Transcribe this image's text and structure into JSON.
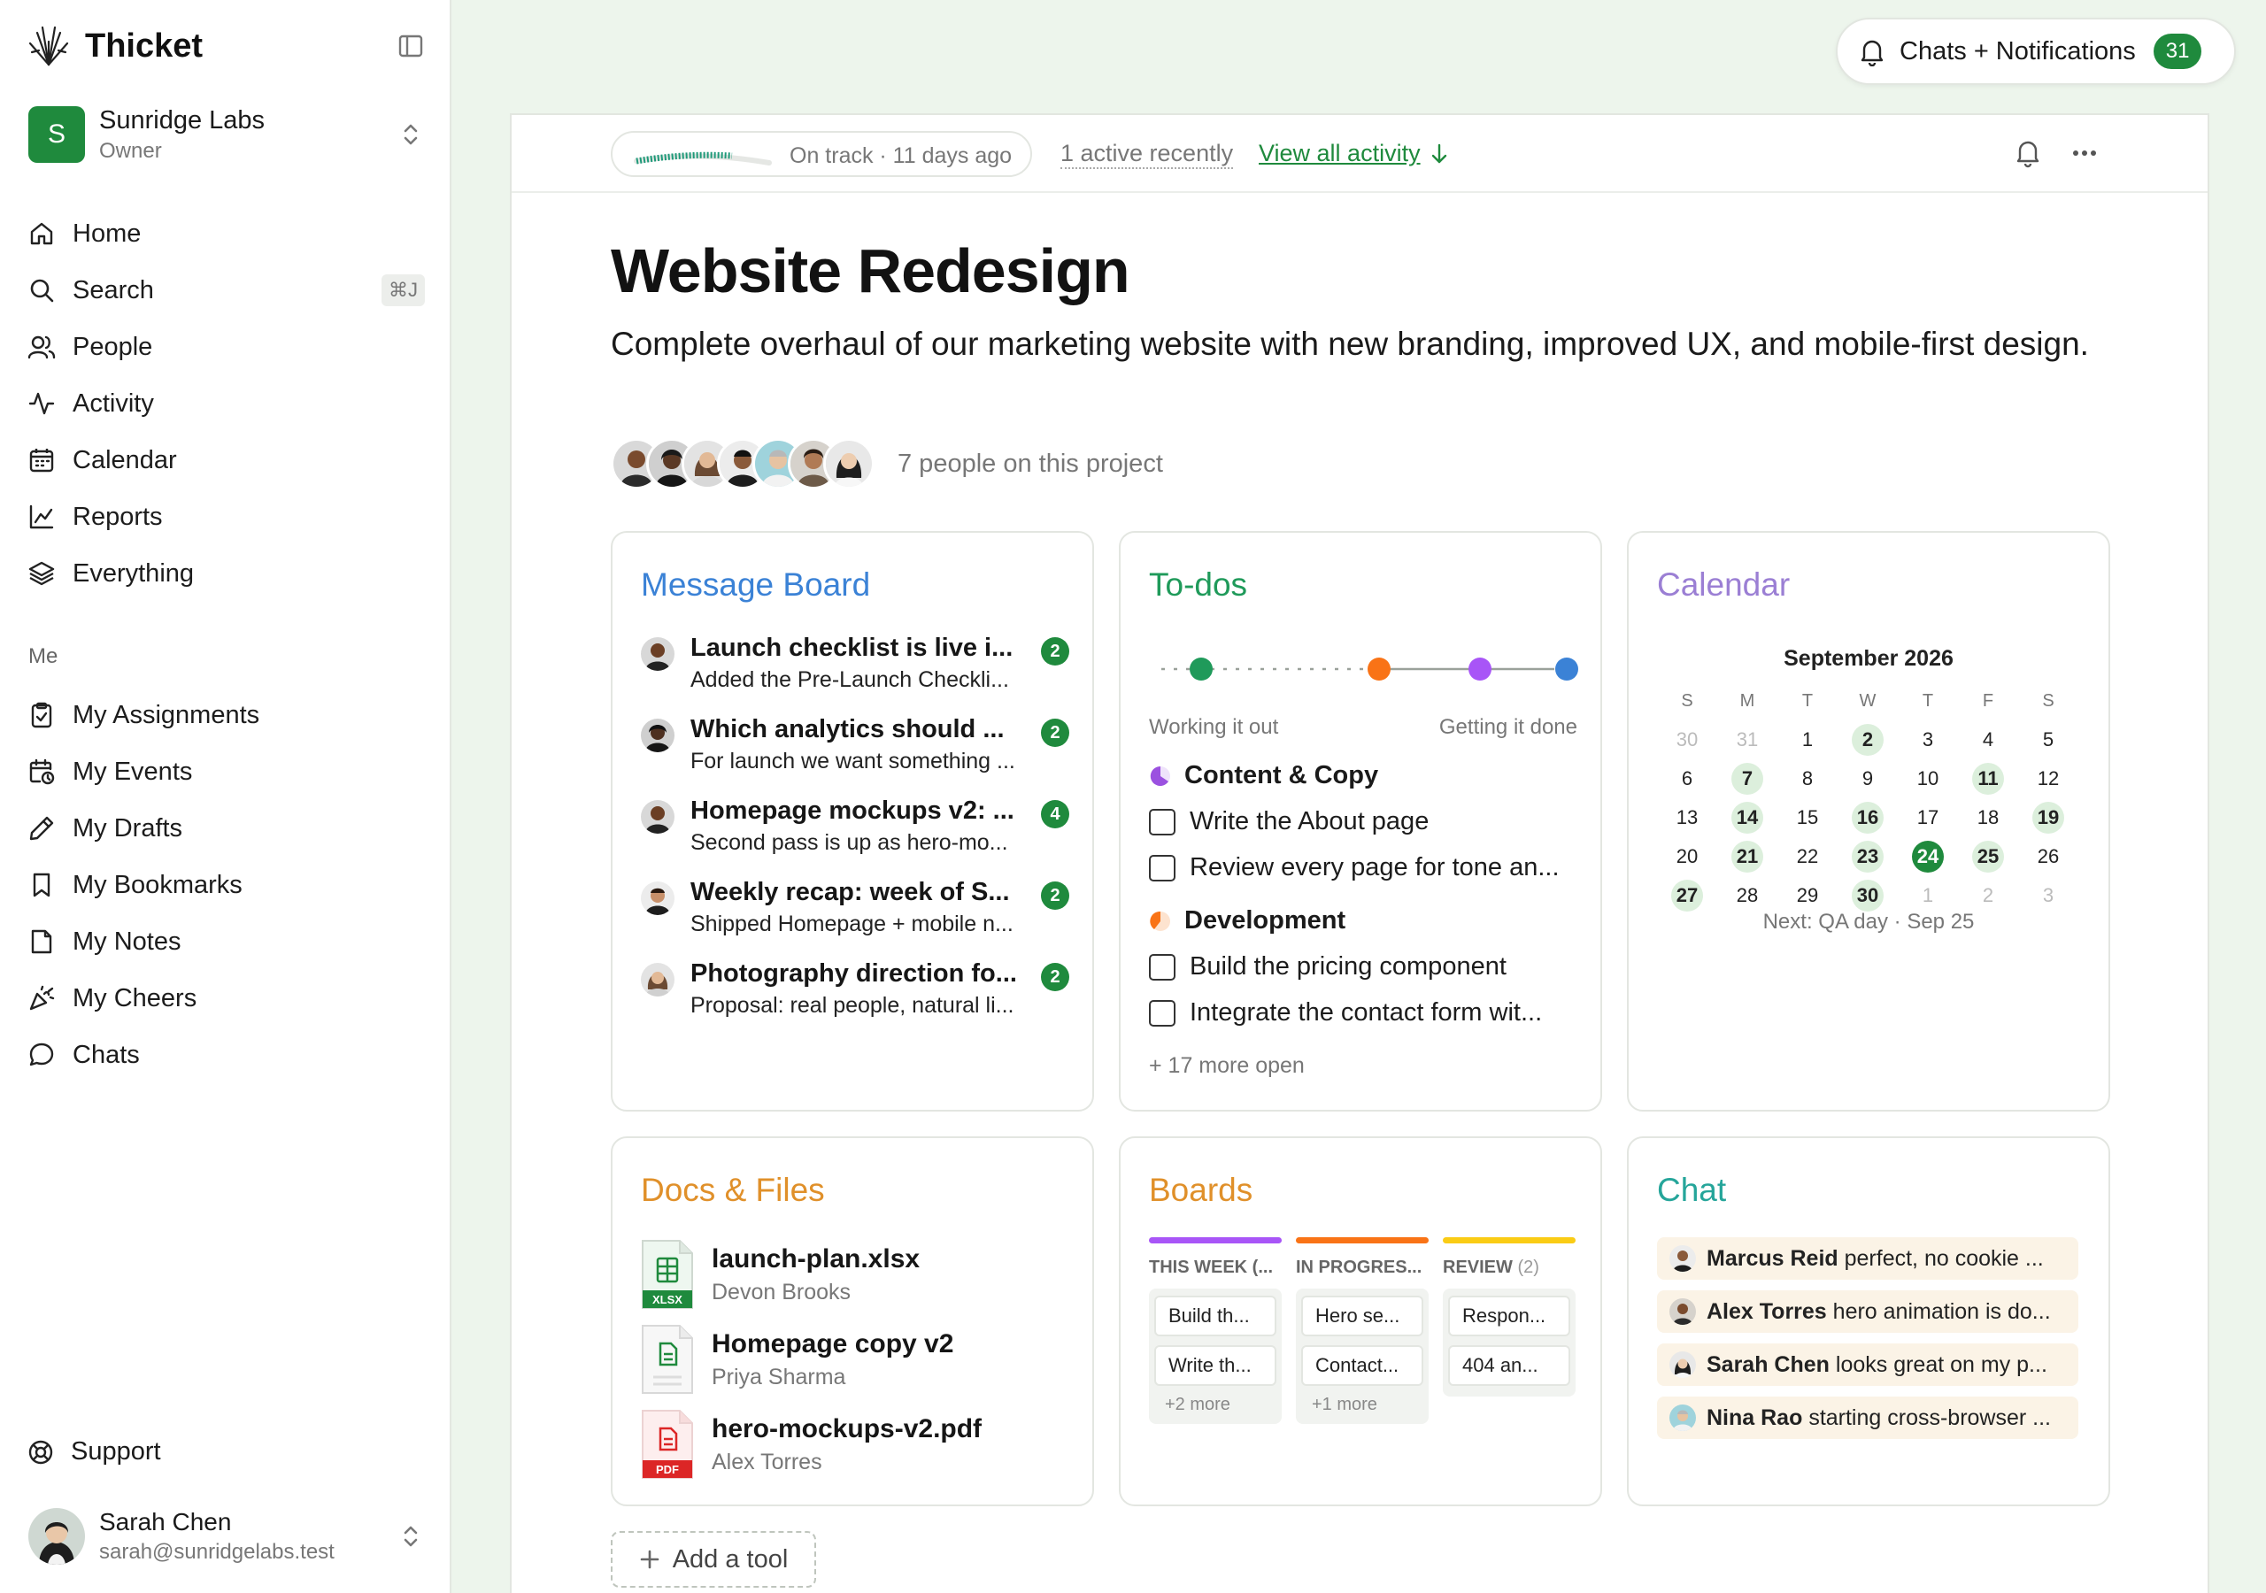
{
  "app": {
    "name": "Thicket"
  },
  "org": {
    "initial": "S",
    "name": "Sunridge Labs",
    "role": "Owner"
  },
  "nav": [
    {
      "label": "Home",
      "icon": "home-icon"
    },
    {
      "label": "Search",
      "icon": "search-icon",
      "shortcut": "⌘J"
    },
    {
      "label": "People",
      "icon": "people-icon"
    },
    {
      "label": "Activity",
      "icon": "activity-icon"
    },
    {
      "label": "Calendar",
      "icon": "calendar-icon"
    },
    {
      "label": "Reports",
      "icon": "reports-icon"
    },
    {
      "label": "Everything",
      "icon": "layers-icon"
    }
  ],
  "me_section": {
    "label": "Me",
    "items": [
      {
        "label": "My Assignments",
        "icon": "clipboard-check-icon"
      },
      {
        "label": "My Events",
        "icon": "calendar-clock-icon"
      },
      {
        "label": "My Drafts",
        "icon": "pencil-icon"
      },
      {
        "label": "My Bookmarks",
        "icon": "bookmark-icon"
      },
      {
        "label": "My Notes",
        "icon": "note-icon"
      },
      {
        "label": "My Cheers",
        "icon": "party-popper-icon"
      },
      {
        "label": "Chats",
        "icon": "chat-bubble-icon"
      }
    ]
  },
  "support": {
    "label": "Support",
    "icon": "lifebuoy-icon"
  },
  "user": {
    "name": "Sarah Chen",
    "email": "sarah@sunridgelabs.test"
  },
  "notifications": {
    "label": "Chats + Notifications",
    "count": "31"
  },
  "status": {
    "text": "On track · 11 days ago",
    "progress": 0.72
  },
  "activity": {
    "active_recently": "1 active recently",
    "view_all": "View all activity"
  },
  "project": {
    "title": "Website Redesign",
    "description": "Complete overhaul of our marketing website with new branding, improved UX, and mobile-first design.",
    "people_label": "7 people on this project"
  },
  "message_board": {
    "title": "Message Board",
    "color": "#3b82d6",
    "messages": [
      {
        "title": "Launch checklist is live i...",
        "preview": "Added the Pre-Launch Checkli...",
        "count": "2"
      },
      {
        "title": "Which analytics should ...",
        "preview": "For launch we want something ...",
        "count": "2"
      },
      {
        "title": "Homepage mockups v2: ...",
        "preview": "Second pass is up as hero-mo...",
        "count": "4"
      },
      {
        "title": "Weekly recap: week of S...",
        "preview": "Shipped Homepage + mobile n...",
        "count": "2"
      },
      {
        "title": "Photography direction fo...",
        "preview": "Proposal: real people, natural li...",
        "count": "2"
      }
    ]
  },
  "todos": {
    "title": "To-dos",
    "color": "#1f9a5a",
    "hill_left": "Working it out",
    "hill_right": "Getting it done",
    "groups": [
      {
        "name": "Content & Copy",
        "color": "#9b51e0",
        "items": [
          "Write the About page",
          "Review every page for tone an..."
        ]
      },
      {
        "name": "Development",
        "color": "#f97316",
        "items": [
          "Build the pricing component",
          "Integrate the contact form wit..."
        ]
      }
    ],
    "more": "+ 17 more open"
  },
  "calendar": {
    "title": "Calendar",
    "color": "#9b7fd4",
    "month": "September 2026",
    "weekdays": [
      "S",
      "M",
      "T",
      "W",
      "T",
      "F",
      "S"
    ],
    "weeks": [
      [
        "30",
        "31",
        "1",
        "2",
        "3",
        "4",
        "5"
      ],
      [
        "6",
        "7",
        "8",
        "9",
        "10",
        "11",
        "12"
      ],
      [
        "13",
        "14",
        "15",
        "16",
        "17",
        "18",
        "19"
      ],
      [
        "20",
        "21",
        "22",
        "23",
        "24",
        "25",
        "26"
      ],
      [
        "27",
        "28",
        "29",
        "30",
        "1",
        "2",
        "3"
      ]
    ],
    "event_days": [
      "2",
      "7",
      "11",
      "14",
      "16",
      "19",
      "21",
      "23",
      "25",
      "27",
      "30"
    ],
    "today": "24",
    "next": "Next: QA day · Sep 25"
  },
  "docs": {
    "title": "Docs & Files",
    "color": "#e0902a",
    "files": [
      {
        "name": "launch-plan.xlsx",
        "author": "Devon Brooks",
        "type": "XLSX"
      },
      {
        "name": "Homepage copy v2",
        "author": "Priya Sharma",
        "type": ""
      },
      {
        "name": "hero-mockups-v2.pdf",
        "author": "Alex Torres",
        "type": "PDF"
      }
    ]
  },
  "boards": {
    "title": "Boards",
    "color": "#e0902a",
    "columns": [
      {
        "name": "THIS WEEK (...",
        "count": "",
        "color": "#9b51e0",
        "cards": [
          "Build th...",
          "Write th..."
        ],
        "more": "+2 more"
      },
      {
        "name": "IN PROGRES...",
        "count": "",
        "color": "#f97316",
        "cards": [
          "Hero se...",
          "Contact..."
        ],
        "more": "+1 more"
      },
      {
        "name": "REVIEW",
        "count": "(2)",
        "color": "#facc15",
        "cards": [
          "Respon...",
          "404 an..."
        ],
        "more": ""
      }
    ]
  },
  "chat": {
    "title": "Chat",
    "color": "#25a59a",
    "lines": [
      {
        "name": "Marcus Reid",
        "text": "perfect, no cookie ..."
      },
      {
        "name": "Alex Torres",
        "text": "hero animation is do..."
      },
      {
        "name": "Sarah Chen",
        "text": "looks great on my p..."
      },
      {
        "name": "Nina Rao",
        "text": "starting cross-browser ..."
      }
    ]
  },
  "add_tool": "Add a tool"
}
